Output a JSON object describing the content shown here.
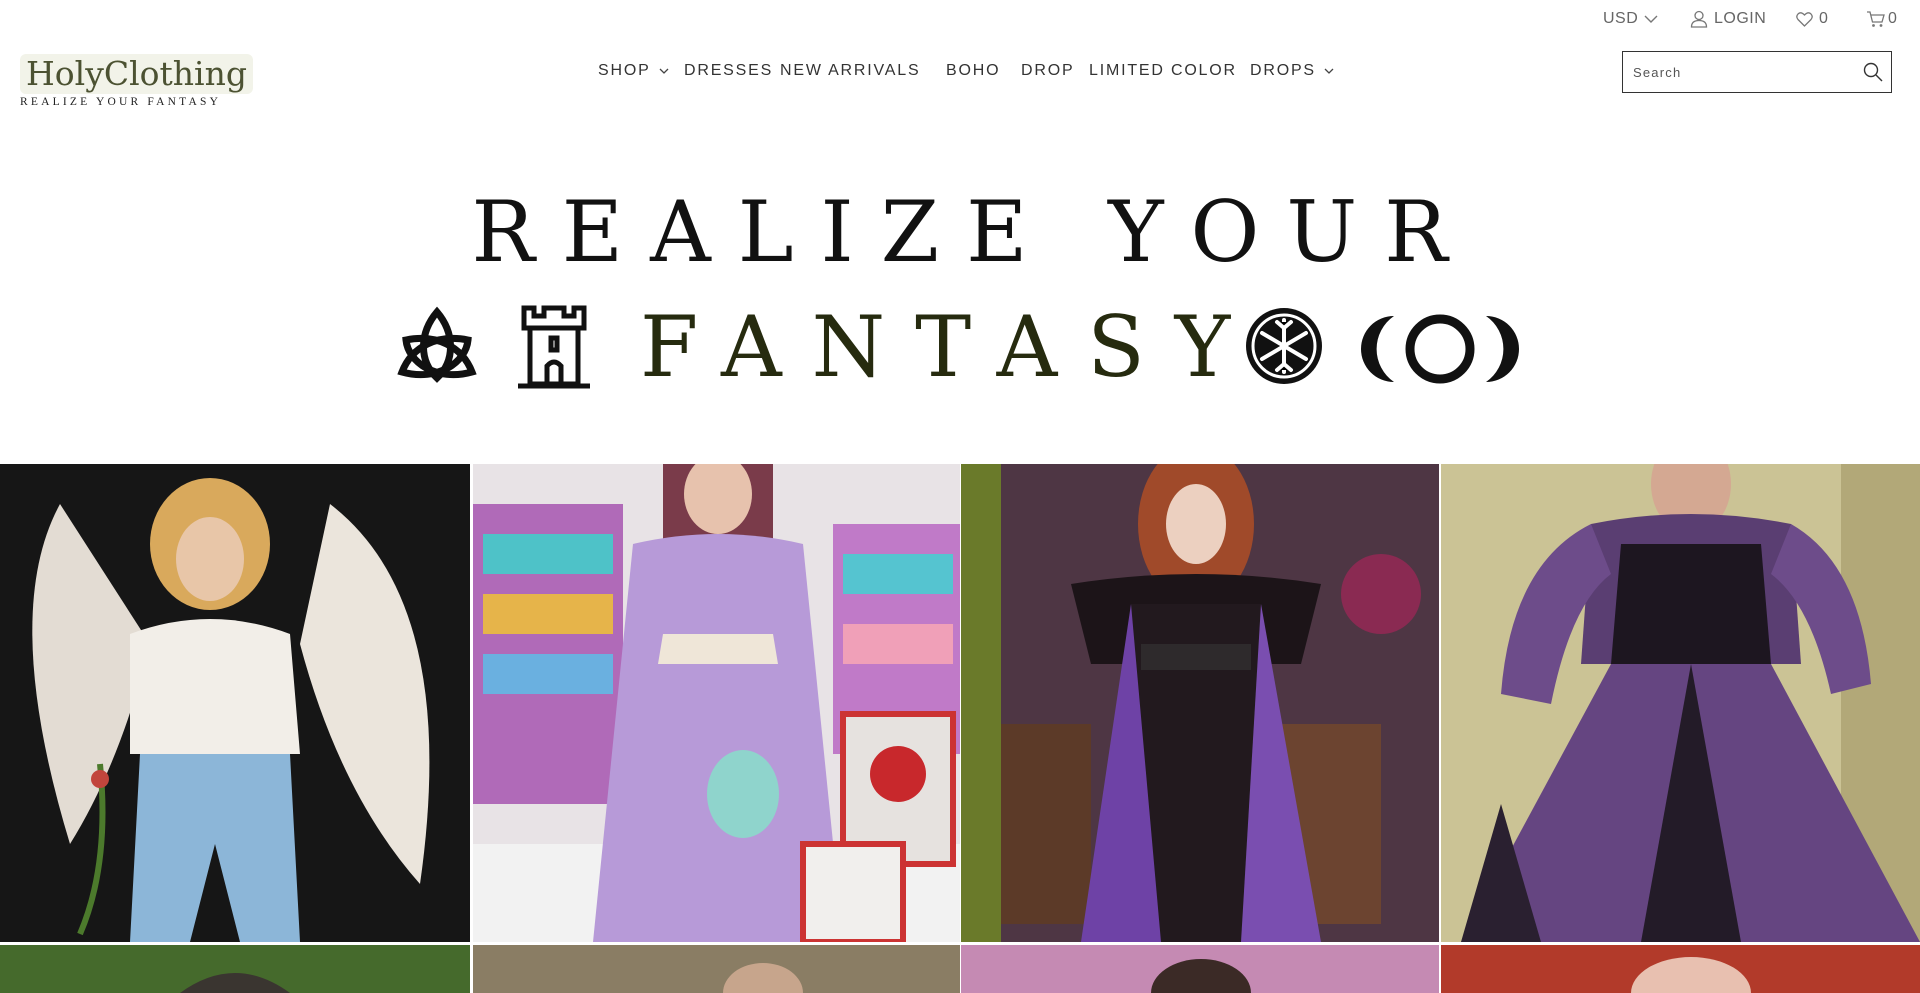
{
  "topbar": {
    "currency": "USD",
    "login": "LOGIN",
    "wishlist_count": "0",
    "cart_count": "0"
  },
  "logo": {
    "wordmark": "HolyClothing",
    "tagline": "REALIZE YOUR FANTASY"
  },
  "nav": {
    "items": [
      {
        "label": "SHOP",
        "dropdown": true
      },
      {
        "label": "DRESSES",
        "dropdown": false
      },
      {
        "label": "NEW ARRIVALS",
        "dropdown": false
      },
      {
        "label": "BOHO",
        "dropdown": false
      },
      {
        "label": "DROP",
        "dropdown": false
      },
      {
        "label": "LIMITED COLOR",
        "dropdown": false
      },
      {
        "label": "DROPS",
        "dropdown": true
      }
    ]
  },
  "search": {
    "placeholder": "Search"
  },
  "hero": {
    "line1": "REALIZE YOUR",
    "line2": "FANTASY",
    "symbols": [
      "triquetra-icon",
      "castle-tower-icon",
      "snowflake-rune-icon",
      "triple-moon-icon"
    ]
  },
  "gallery": {
    "tiles": [
      {
        "name": "photo-white-winged-blouse-blue-pants",
        "colors": [
          "#1a1a1a",
          "#d8cfc4",
          "#8fb8d8"
        ]
      },
      {
        "name": "photo-lavender-dress-toy-store",
        "colors": [
          "#e9e4ec",
          "#b89ad8",
          "#c94f56"
        ]
      },
      {
        "name": "photo-purple-black-velvet-gown",
        "colors": [
          "#5a3b4c",
          "#6d3fa0",
          "#1c1520"
        ]
      },
      {
        "name": "photo-purple-peasant-dress",
        "colors": [
          "#cfc79a",
          "#6a4a82",
          "#221a26"
        ]
      },
      {
        "name": "photo-garden-hat",
        "colors": [
          "#3e5a2a"
        ]
      },
      {
        "name": "photo-indoor-glasses",
        "colors": [
          "#7a6e58"
        ]
      },
      {
        "name": "photo-pink-floral",
        "colors": [
          "#c88ab2"
        ]
      },
      {
        "name": "photo-red-portrait",
        "colors": [
          "#b23a2a"
        ]
      }
    ]
  }
}
